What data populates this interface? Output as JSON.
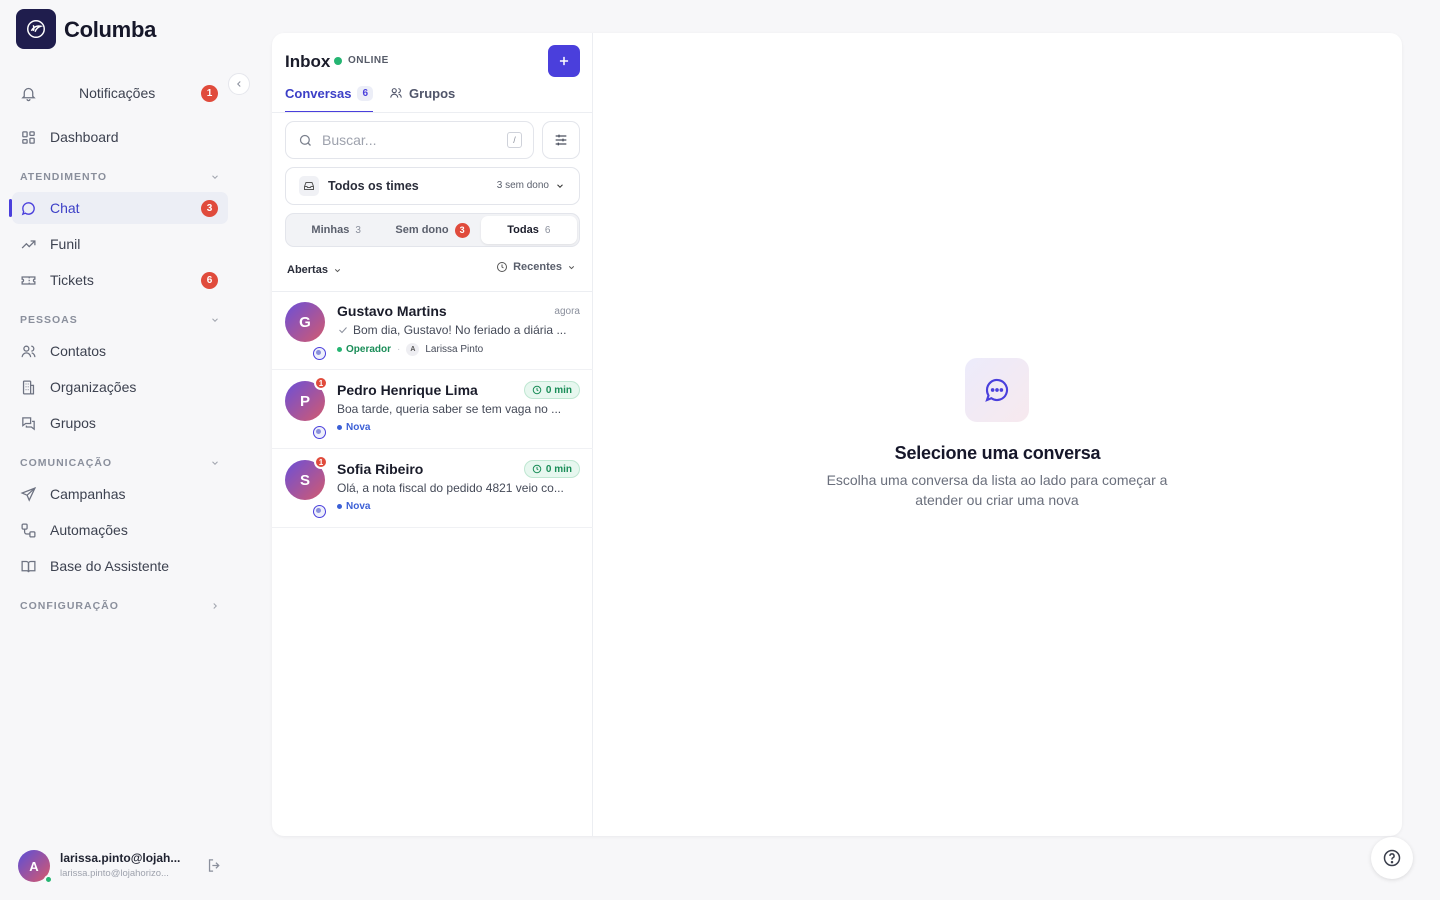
{
  "app": {
    "name": "Columba"
  },
  "sidebar": {
    "notifications": {
      "label": "Notificações",
      "badge": "1"
    },
    "dashboard": {
      "label": "Dashboard"
    },
    "sections": [
      {
        "title": "ATENDIMENTO"
      },
      {
        "title": "PESSOAS"
      },
      {
        "title": "COMUNICAÇÃO"
      },
      {
        "title": "CONFIGURAÇÃO"
      }
    ],
    "items": {
      "chat": {
        "label": "Chat",
        "badge": "3"
      },
      "funil": {
        "label": "Funil"
      },
      "tickets": {
        "label": "Tickets",
        "badge": "6"
      },
      "contatos": {
        "label": "Contatos"
      },
      "organizacoes": {
        "label": "Organizações"
      },
      "grupos": {
        "label": "Grupos"
      },
      "campanhas": {
        "label": "Campanhas"
      },
      "automacoes": {
        "label": "Automações"
      },
      "base": {
        "label": "Base do Assistente"
      }
    },
    "user": {
      "initial": "A",
      "name": "larissa.pinto@lojah...",
      "email": "larissa.pinto@lojahorizo..."
    }
  },
  "inbox": {
    "title": "Inbox",
    "status": "ONLINE",
    "tabs": [
      {
        "label": "Conversas",
        "count": "6"
      },
      {
        "label": "Grupos"
      }
    ],
    "search": {
      "placeholder": "Buscar...",
      "shortcut": "/"
    },
    "team_select": {
      "value": "Todos os times",
      "info": "3 sem dono"
    },
    "segments": [
      {
        "label": "Minhas",
        "count": "3"
      },
      {
        "label": "Sem dono",
        "count": "3"
      },
      {
        "label": "Todas",
        "count": "6"
      }
    ],
    "status_filter": "Abertas",
    "sort": "Recentes",
    "conversations": [
      {
        "initial": "G",
        "name": "Gustavo Martins",
        "time": "agora",
        "message": "Bom dia, Gustavo! No feriado a diária ...",
        "tag": "Operador",
        "agent_initial": "A",
        "agent": "Larissa Pinto"
      },
      {
        "initial": "P",
        "name": "Pedro Henrique Lima",
        "timer": "0 min",
        "unread": "1",
        "message": "Boa tarde, queria saber se tem vaga no ...",
        "tag": "Nova"
      },
      {
        "initial": "S",
        "name": "Sofia Ribeiro",
        "timer": "0 min",
        "unread": "1",
        "message": "Olá, a nota fiscal do pedido 4821 veio co...",
        "tag": "Nova"
      }
    ]
  },
  "empty_state": {
    "title": "Selecione uma conversa",
    "subtitle": "Escolha uma conversa da lista ao lado para começar a atender ou criar uma nova"
  },
  "colors": {
    "accent": "#4a3fdc",
    "badge": "#e04b3c",
    "online": "#25b572",
    "operator": "#1a8d58",
    "new": "#3b5fd6"
  }
}
